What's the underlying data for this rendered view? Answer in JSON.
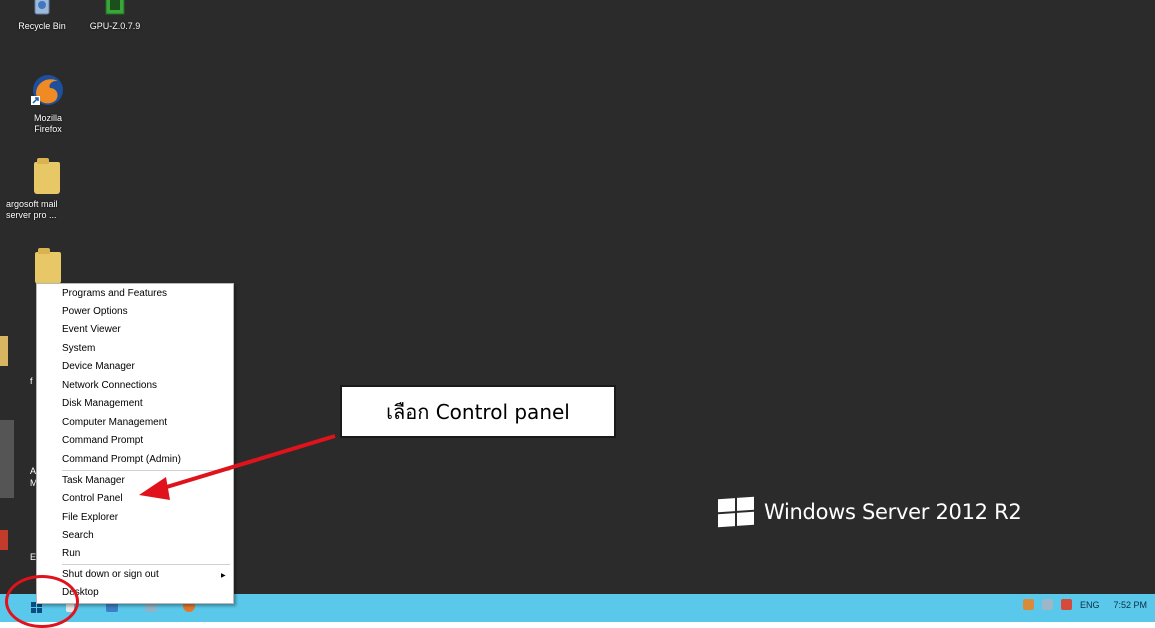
{
  "desktop": {
    "icons": [
      {
        "label": "Recycle Bin",
        "icon": "recycle-bin-icon"
      },
      {
        "label": "GPU-Z.0.7.9",
        "icon": "gpu-z-icon"
      },
      {
        "label": "Mozilla Firefox",
        "icon": "firefox-icon"
      },
      {
        "label": "argosoft mail server pro ...",
        "icon": "folder-icon"
      },
      {
        "label": "",
        "icon": "folder-icon"
      }
    ],
    "partial_labels": [
      "f",
      "A",
      "M",
      "E"
    ],
    "branding": "Windows Server 2012 R2"
  },
  "context_menu": {
    "items": [
      {
        "label": "Programs and Features"
      },
      {
        "label": "Power Options"
      },
      {
        "label": "Event Viewer"
      },
      {
        "label": "System"
      },
      {
        "label": "Device Manager"
      },
      {
        "label": "Network Connections"
      },
      {
        "label": "Disk Management"
      },
      {
        "label": "Computer Management"
      },
      {
        "label": "Command Prompt"
      },
      {
        "label": "Command Prompt (Admin)"
      },
      {
        "label": "Task Manager"
      },
      {
        "label": "Control Panel"
      },
      {
        "label": "File Explorer"
      },
      {
        "label": "Search"
      },
      {
        "label": "Run"
      },
      {
        "label": "Shut down or sign out",
        "has_submenu": true
      },
      {
        "label": "Desktop"
      }
    ]
  },
  "annotation": {
    "callout_text": "เลือก Control panel",
    "arrow_color": "#e0121c",
    "circle_color": "#e0121c"
  },
  "taskbar": {
    "color": "#5ac8ea",
    "tray": {
      "language": "ENG",
      "time": "7:52 PM"
    }
  }
}
